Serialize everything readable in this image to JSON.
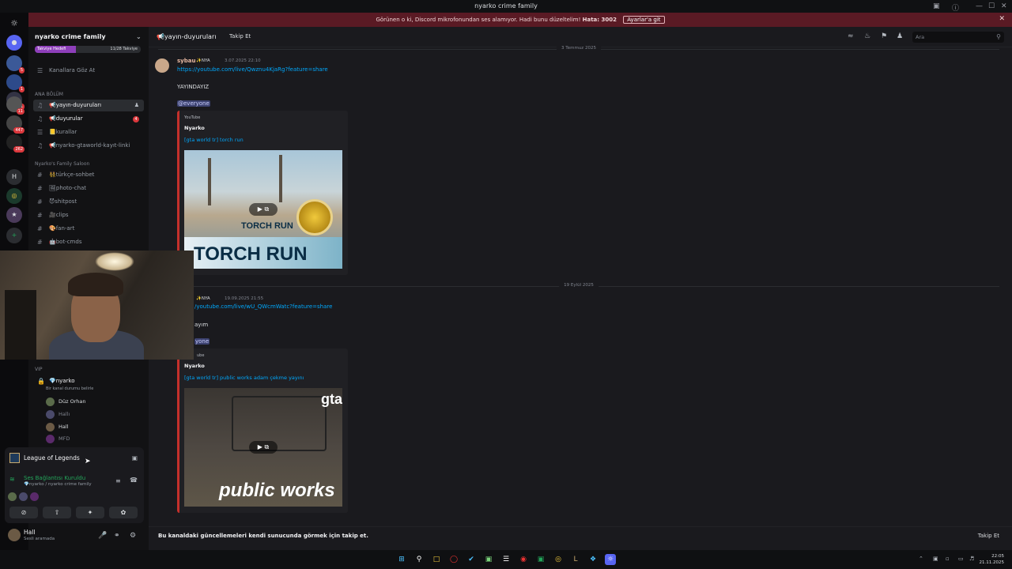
{
  "window": {
    "title": "nyarko crime family",
    "controls": [
      "—",
      "☐",
      "✕"
    ]
  },
  "banner": {
    "text": "Görünen o ki, Discord mikrofonundan ses alamıyor. Hadi bunu düzeltelim!",
    "error": "Hata: 3002",
    "button": "Ayarlar'a git",
    "close": "✕"
  },
  "servers": {
    "badges": [
      "5",
      "1",
      "1",
      "11",
      "447",
      "262"
    ],
    "home_letter": "H",
    "add": "+"
  },
  "guild": {
    "name": "nyarko crime family",
    "boost_label": "Takviye Hedefi",
    "boost_count": "11/28 Takviye",
    "boost_progress": 0.39,
    "browse": "Kanallara Göz At",
    "categories": {
      "main": "ANA BÖLÜM",
      "saloon": "Nyarko's Family Saloon",
      "vip": "VIP"
    },
    "channels_main": [
      {
        "name": "📢yayın-duyuruları",
        "icon": "♫"
      },
      {
        "name": "📢duyurular",
        "icon": "♫",
        "count": "4"
      },
      {
        "name": "📒kurallar",
        "icon": "☰"
      },
      {
        "name": "📢nyarko-gtaworld-kayıt-linki",
        "icon": "♫"
      }
    ],
    "channels_saloon": [
      {
        "name": "👯türkçe-sohbet",
        "icon": "#"
      },
      {
        "name": "🖼photo-chat",
        "icon": "#"
      },
      {
        "name": "😈shitpost",
        "icon": "#"
      },
      {
        "name": "🎥clips",
        "icon": "#"
      },
      {
        "name": "🎨fan-art",
        "icon": "#"
      },
      {
        "name": "🤖bot-cmds",
        "icon": "#"
      }
    ],
    "voice_channel": {
      "name": "💎nyarko",
      "status": "Bir kanal durumu belirle"
    },
    "members": [
      "Düz Orhan",
      "Hallı",
      "Hall",
      "MFD"
    ]
  },
  "panel": {
    "game": "League of Legends",
    "voice_status": "Ses Bağlantısı Kuruldu",
    "voice_sub": "💎nyarko / nyarko crime family",
    "buttons": [
      "⊘",
      "⇧",
      "✦",
      "✿"
    ]
  },
  "user": {
    "name": "Hall",
    "status": "Sesli aramada"
  },
  "header": {
    "channel": "📢yayın-duyuruları",
    "follow": "Takip Et",
    "search_placeholder": "Ara"
  },
  "messages": [
    {
      "date": "3 Temmuz 2025",
      "author": "sybau",
      "tag": "✨NYA",
      "time": "3.07.2025 22:10",
      "link": "https://youtube.com/live/Qwznu4KjaRg?feature=share",
      "text": "YAYINDAYIZ",
      "mention": "@everyone",
      "embed": {
        "provider": "YouTube",
        "author": "Nyarko",
        "title": "[gta world tr] torch run",
        "thumb_big": "TORCH RUN",
        "thumb_mid": "TORCH RUN",
        "color": "#c4302b"
      }
    },
    {
      "date": "19 Eylül 2025",
      "author": "",
      "tag": "✨NYA",
      "time": "19.09.2025 21:55",
      "link": "/youtube.com/live/wU_QWcmWatc?feature=share",
      "text": "ayım",
      "mention": "yone",
      "embed": {
        "provider": "ube",
        "author": "Nyarko",
        "title": "[gta world tr] public works adam çekme yayını",
        "thumb_big": "public works",
        "thumb_corner": "gta",
        "color": "#c4302b"
      }
    }
  ],
  "footer": {
    "text": "Bu kanaldaki güncellemeleri kendi sunucunda görmek için takip et.",
    "button": "Takip Et"
  },
  "taskbar": {
    "time": "22:05",
    "date": "21.11.2025"
  }
}
